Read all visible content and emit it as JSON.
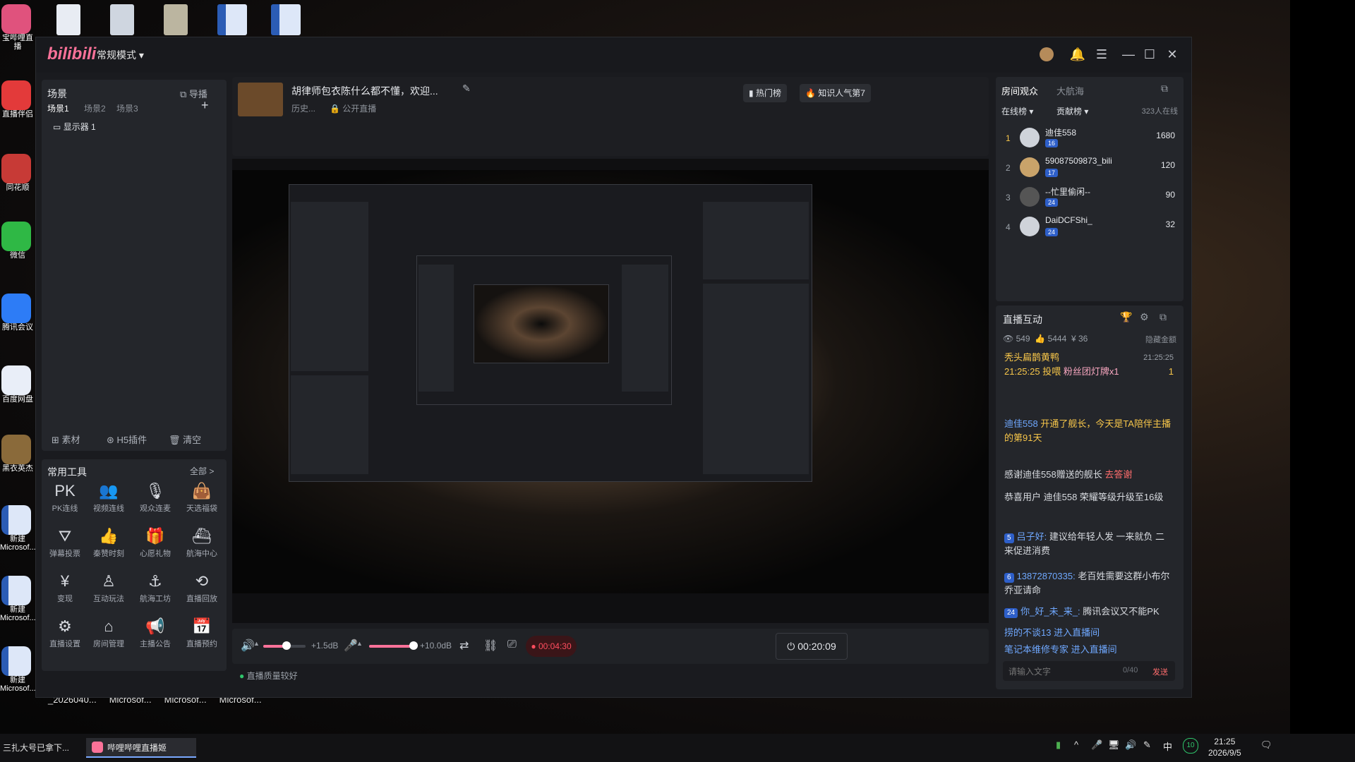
{
  "desktop": {
    "left_icons": [
      {
        "label": "宝哔哩直播"
      },
      {
        "label": "直播伴侣"
      },
      {
        "label": "同花顺"
      },
      {
        "label": "微信"
      },
      {
        "label": "腾讯会议"
      },
      {
        "label": "百度网盘"
      },
      {
        "label": "黑衣英杰"
      },
      {
        "label": "新建 Microsof..."
      },
      {
        "label": "新建 Microsof..."
      },
      {
        "label": "新建 Microsof..."
      }
    ],
    "bottom_labels": [
      "_2026040...",
      "Microsof...",
      "Microsof...",
      "Microsof..."
    ]
  },
  "app": {
    "logo": "bilibili",
    "mode": "常规模式",
    "scene": {
      "title": "场景",
      "import": "导播",
      "tabs": [
        "场景1",
        "场景2",
        "场景3"
      ],
      "add": "+",
      "items": [
        "显示器 1"
      ],
      "footer": [
        "素材",
        "H5插件",
        "清空"
      ]
    },
    "tools": {
      "title": "常用工具",
      "all": "全部 >",
      "items": [
        {
          "label": "PK连线",
          "icon": "pk-icon"
        },
        {
          "label": "视频连线",
          "icon": "video-link-icon"
        },
        {
          "label": "观众连麦",
          "icon": "mic-icon"
        },
        {
          "label": "天选福袋",
          "icon": "gift-bag-icon"
        },
        {
          "label": "弹幕投票",
          "icon": "vote-icon"
        },
        {
          "label": "秦赞时刻",
          "icon": "like-icon"
        },
        {
          "label": "心愿礼物",
          "icon": "wish-gift-icon"
        },
        {
          "label": "航海中心",
          "icon": "ship-center-icon"
        },
        {
          "label": "变现",
          "icon": "money-icon"
        },
        {
          "label": "互动玩法",
          "icon": "interact-icon"
        },
        {
          "label": "航海工坊",
          "icon": "workshop-icon"
        },
        {
          "label": "直播回放",
          "icon": "replay-icon"
        },
        {
          "label": "直播设置",
          "icon": "settings-icon"
        },
        {
          "label": "房间管理",
          "icon": "room-manage-icon"
        },
        {
          "label": "主播公告",
          "icon": "announce-icon"
        },
        {
          "label": "直播预约",
          "icon": "reserve-icon"
        }
      ]
    },
    "stream": {
      "title": "胡律师包衣陈什么都不懂，欢迎...",
      "history": "历史...",
      "public": "公开直播",
      "hot_rank": "热门榜",
      "knowledge": "知识人气第7"
    },
    "controls": {
      "speaker_db": "+1.5dB",
      "mic_db": "+10.0dB",
      "speaker_level": 0.55,
      "mic_level": 0.95,
      "rec_time": "00:04:30",
      "live_time": "00:20:09",
      "status": "直播质量较好"
    },
    "audience": {
      "tabs": [
        "房间观众",
        "大航海"
      ],
      "sub_tabs": [
        "在线榜",
        "贡献榜"
      ],
      "online": "323人在线",
      "rows": [
        {
          "rank": "1",
          "name": "迪佳558",
          "level": "16",
          "score": "1680"
        },
        {
          "rank": "2",
          "name": "59087509873_bili",
          "level": "17",
          "score": "120"
        },
        {
          "rank": "3",
          "name": "--忙里偷闲--",
          "level": "24",
          "score": "90"
        },
        {
          "rank": "4",
          "name": "DaiDCFShi_",
          "level": "24",
          "score": "32"
        }
      ]
    },
    "interact": {
      "title": "直播互动",
      "stats": {
        "viewers": "549",
        "likes": "5444",
        "coins": "36"
      },
      "hide": "隐藏金额",
      "gift_user": "秃头扁鹊黄鸭",
      "gift_time": "21:25:25",
      "gift_action": "21:25:25 投喂",
      "gift_name": "粉丝团灯牌x1",
      "gift_count": "1",
      "messages": [
        {
          "user": "迪佳558",
          "text": "开通了舰长，今天是TA陪伴主播的第91天"
        },
        {
          "user": "",
          "text": "感谢迪佳558赠送的舰长",
          "tag": "去答谢"
        },
        {
          "user": "",
          "text": "恭喜用户 迪佳558 荣耀等级升级至16级"
        },
        {
          "user": "吕子好:",
          "level": "5",
          "text": "建议给年轻人发 一来就负 二来促进消费"
        },
        {
          "user": "13872870335:",
          "level": "6",
          "text": "老百姓需要这群小布尔乔亚请命"
        },
        {
          "user": "你_好_未_来_:",
          "level": "24",
          "text": "腾讯会议又不能PK"
        },
        {
          "user": "",
          "text": "捞的不谈13 进入直播间"
        },
        {
          "user": "",
          "text": "笔记本维修专家 进入直播间"
        }
      ],
      "input_placeholder": "请输入文字",
      "counter": "0/40",
      "send": "发送"
    }
  },
  "taskbar": {
    "items": [
      "三扎大号已拿下...",
      "哔哩哔哩直播姬"
    ],
    "ime": "中",
    "badge": "10",
    "time": "21:25",
    "date": "2026/9/5"
  },
  "colors": {
    "accent": "#fb7299",
    "panel": "#24262b",
    "link": "#6fa8ff",
    "gold": "#f7c64a"
  }
}
